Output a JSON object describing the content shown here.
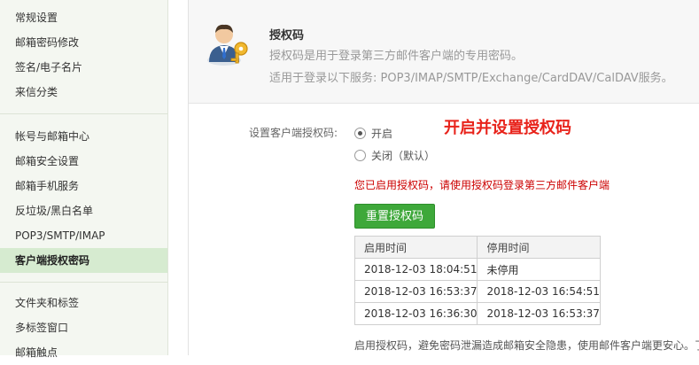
{
  "sidebar": {
    "items": [
      {
        "label": "常规设置",
        "active": false
      },
      {
        "label": "邮箱密码修改",
        "active": false
      },
      {
        "label": "签名/电子名片",
        "active": false
      },
      {
        "label": "来信分类",
        "active": false
      },
      {
        "label": "帐号与邮箱中心",
        "active": false
      },
      {
        "label": "邮箱安全设置",
        "active": false
      },
      {
        "label": "邮箱手机服务",
        "active": false
      },
      {
        "label": "反垃圾/黑白名单",
        "active": false
      },
      {
        "label": "POP3/SMTP/IMAP",
        "active": false
      },
      {
        "label": "客户端授权密码",
        "active": true
      },
      {
        "label": "文件夹和标签",
        "active": false
      },
      {
        "label": "多标签窗口",
        "active": false
      },
      {
        "label": "邮箱触点",
        "active": false
      }
    ]
  },
  "header": {
    "title": "授权码",
    "description": "授权码是用于登录第三方邮件客户端的专用密码。",
    "services": "适用于登录以下服务: POP3/IMAP/SMTP/Exchange/CardDAV/CalDAV服务。",
    "icon": "user-key-icon"
  },
  "settings": {
    "label": "设置客户端授权码:",
    "option_on": "开启",
    "option_off": "关闭（默认）",
    "selected": "开启",
    "annotation": "开启并设置授权码",
    "enabled_message": "您已启用授权码，请使用授权码登录第三方邮件客户端",
    "reset_button": "重置授权码"
  },
  "history": {
    "columns": [
      "启用时间",
      "停用时间"
    ],
    "rows": [
      [
        "2018-12-03 18:04:51",
        "未停用"
      ],
      [
        "2018-12-03 16:53:37",
        "2018-12-03 16:54:51"
      ],
      [
        "2018-12-03 16:36:30",
        "2018-12-03 16:53:37"
      ]
    ]
  },
  "footer_note": "启用授权码，避免密码泄漏造成邮箱安全隐患，使用邮件客户端更安心。了",
  "colors": {
    "accent_green": "#3ea83a",
    "annotation_red": "#e8231b",
    "message_red": "#cc0000",
    "sidebar_bg": "#f4f7f1",
    "sidebar_active": "#d6ebd0"
  }
}
